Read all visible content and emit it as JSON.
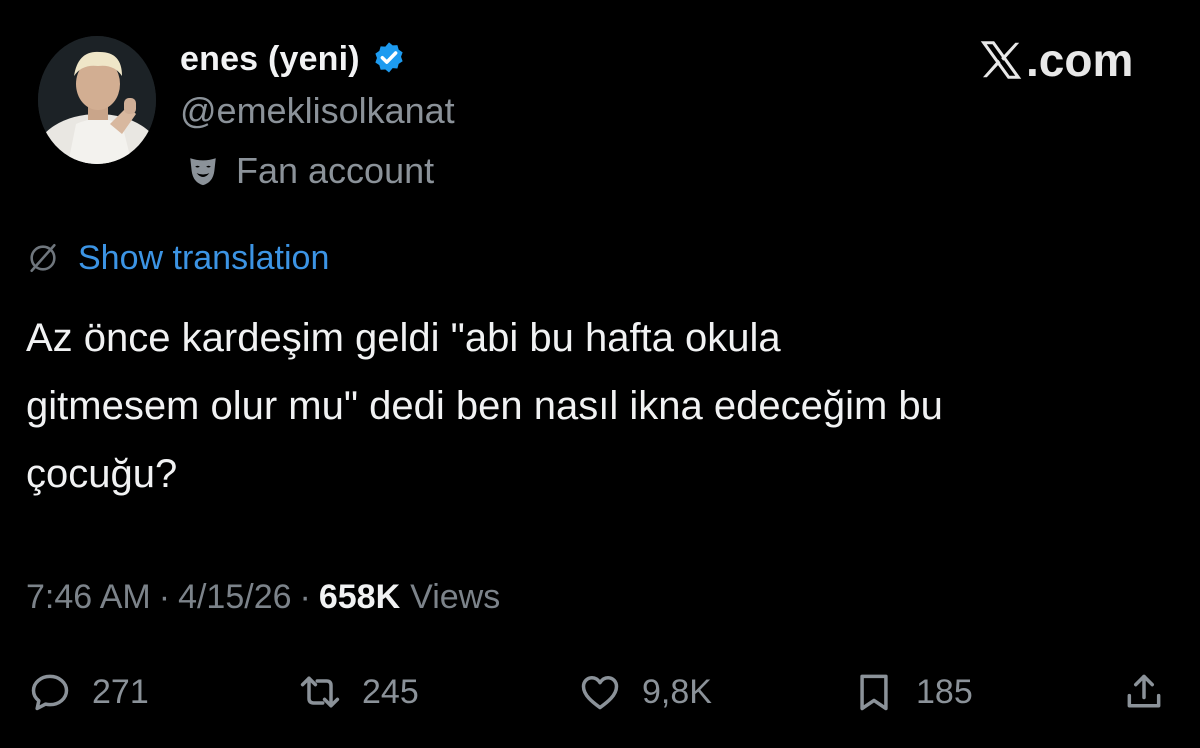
{
  "header": {
    "display_name": "enes (yeni)",
    "handle": "@emeklisolkanat",
    "affiliation_label": "Fan account",
    "verified_icon": "verified-badge-icon",
    "affiliation_icon": "theater-mask-icon"
  },
  "brand": {
    "logo_text": ".com",
    "logo_icon": "x-logo-icon"
  },
  "translation": {
    "link_label": "Show translation",
    "icon": "translate-globe-icon"
  },
  "tweet": {
    "text": "Az önce kardeşim geldi \"abi bu hafta okula\ngitmesem olur mu\" dedi ben nasıl ikna edeceğim bu\nçocuğu?"
  },
  "meta": {
    "time": "7:46 AM",
    "separator": "·",
    "date": "4/15/26",
    "views_count": "658K",
    "views_label": "Views"
  },
  "actions": {
    "reply_count": "271",
    "retweet_count": "245",
    "like_count": "9,8K",
    "bookmark_count": "185"
  },
  "colors": {
    "background": "#000000",
    "primary_text": "#f1f2f3",
    "secondary_text": "#8b9299",
    "link": "#3c94e4",
    "verified": "#1d9bf0"
  }
}
